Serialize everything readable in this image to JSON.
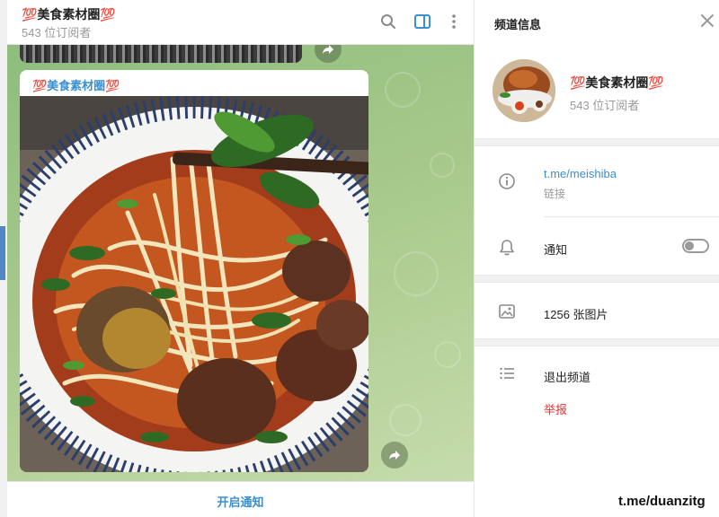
{
  "chat": {
    "title": "💯美食素材圈💯",
    "subscribers": "543 位订阅者",
    "message": {
      "author": "💯美食素材圈💯"
    },
    "footer_button": "开启通知"
  },
  "panel": {
    "title": "频道信息",
    "channel_name": "💯美食素材圈💯",
    "channel_subscribers": "543 位订阅者",
    "link": {
      "value": "t.me/meishiba",
      "caption": "链接"
    },
    "notifications": {
      "label": "通知",
      "enabled": false
    },
    "media": {
      "label": "1256 张图片"
    },
    "leave": {
      "label": "退出频道"
    },
    "report": {
      "label": "举报"
    }
  },
  "watermark": "t.me/duanzitg",
  "icons": {
    "search": "search-icon",
    "sidebar_toggle": "sidebar-toggle-icon",
    "more": "more-vertical-icon",
    "close": "close-icon",
    "info": "info-icon",
    "bell": "bell-icon",
    "photo": "photo-icon",
    "list": "list-icon",
    "forward": "forward-icon"
  },
  "colors": {
    "accent": "#3a8fd1",
    "danger": "#e53935",
    "chat_bg": "#a6c98b"
  }
}
